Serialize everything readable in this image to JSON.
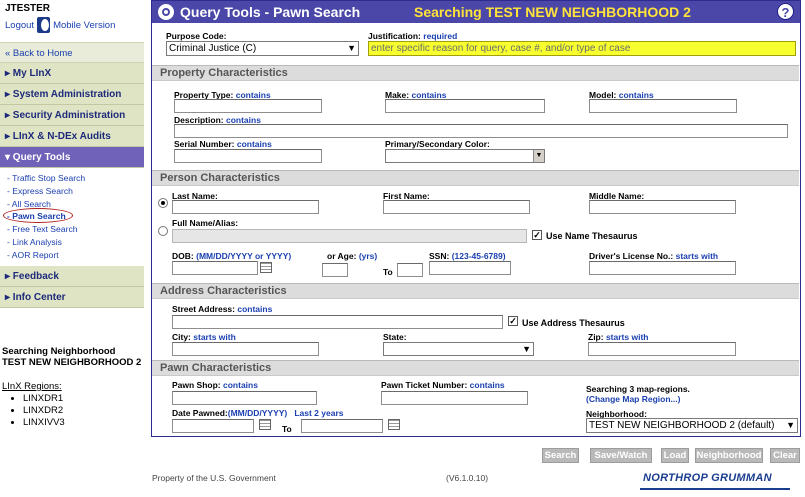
{
  "sidebar": {
    "username": "JTESTER",
    "logout": "Logout",
    "mobile": "Mobile Version",
    "back": "« Back to Home",
    "sections": [
      {
        "label": "▸ My LInX"
      },
      {
        "label": "▸ System Administration"
      },
      {
        "label": "▸ Security Administration"
      },
      {
        "label": "▸ LInX & N-DEx Audits"
      },
      {
        "label": "▾ Query Tools"
      }
    ],
    "query_items": [
      "- Traffic Stop Search",
      "- Express Search",
      "- All Search",
      "- Pawn Search",
      "- Free Text Search",
      "- Link Analysis",
      "- AOR Report"
    ],
    "sections_after": [
      {
        "label": "▸ Feedback"
      },
      {
        "label": "▸ Info Center"
      }
    ],
    "neighborhood_heading": "Searching Neighborhood TEST NEW NEIGHBORHOOD 2",
    "regions_label": "LInX Regions:",
    "regions": [
      "LINXDR1",
      "LINXDR2",
      "LINXIVV3"
    ]
  },
  "header": {
    "title": "Query Tools - Pawn Search",
    "searching": "Searching TEST NEW NEIGHBORHOOD 2",
    "help": "?"
  },
  "purpose": {
    "label": "Purpose Code:",
    "value": "Criminal Justice (C)",
    "justification_label": "Justification:",
    "required": "required",
    "justification_placeholder": "enter specific reason for query, case #, and/or type of case"
  },
  "property": {
    "header": "Property Characteristics",
    "type_label": "Property Type:",
    "make_label": "Make:",
    "model_label": "Model:",
    "description_label": "Description:",
    "serial_label": "Serial Number:",
    "color_label": "Primary/Secondary Color:",
    "contains": "contains"
  },
  "person": {
    "header": "Person Characteristics",
    "last_label": "Last Name:",
    "first_label": "First Name:",
    "middle_label": "Middle Name:",
    "full_label": "Full Name/Alias:",
    "thesaurus": "Use Name Thesaurus",
    "dob_label": "DOB:",
    "dob_format": "(MM/DD/YYYY or YYYY)",
    "age_label": "or Age:",
    "age_unit": "(yrs)",
    "to": "To",
    "ssn_label": "SSN:",
    "ssn_format": "(123-45-6789)",
    "dl_label": "Driver's License No.:",
    "starts_with": "starts with"
  },
  "address": {
    "header": "Address Characteristics",
    "street_label": "Street Address:",
    "contains": "contains",
    "thesaurus": "Use Address Thesaurus",
    "city_label": "City:",
    "state_label": "State:",
    "zip_label": "Zip:",
    "starts_with": "starts with"
  },
  "pawn": {
    "header": "Pawn Characteristics",
    "shop_label": "Pawn Shop:",
    "ticket_label": "Pawn Ticket Number:",
    "contains": "contains",
    "searching_regions": "Searching 3 map-regions.",
    "change_map": "(Change Map Region...)",
    "date_label": "Date Pawned:",
    "date_format": "(MM/DD/YYYY)",
    "last2": "Last 2 years",
    "to": "To",
    "neighborhood_label": "Neighborhood:",
    "neighborhood_value": "TEST NEW NEIGHBORHOOD 2 (default)"
  },
  "buttons": {
    "search": "Search",
    "save": "Save/Watch",
    "load": "Load",
    "neighborhood": "Neighborhood",
    "clear": "Clear"
  },
  "footer": {
    "property": "Property of the U.S. Government",
    "version": "(V6.1.0.10)",
    "company": "NORTHROP GRUMMAN"
  }
}
